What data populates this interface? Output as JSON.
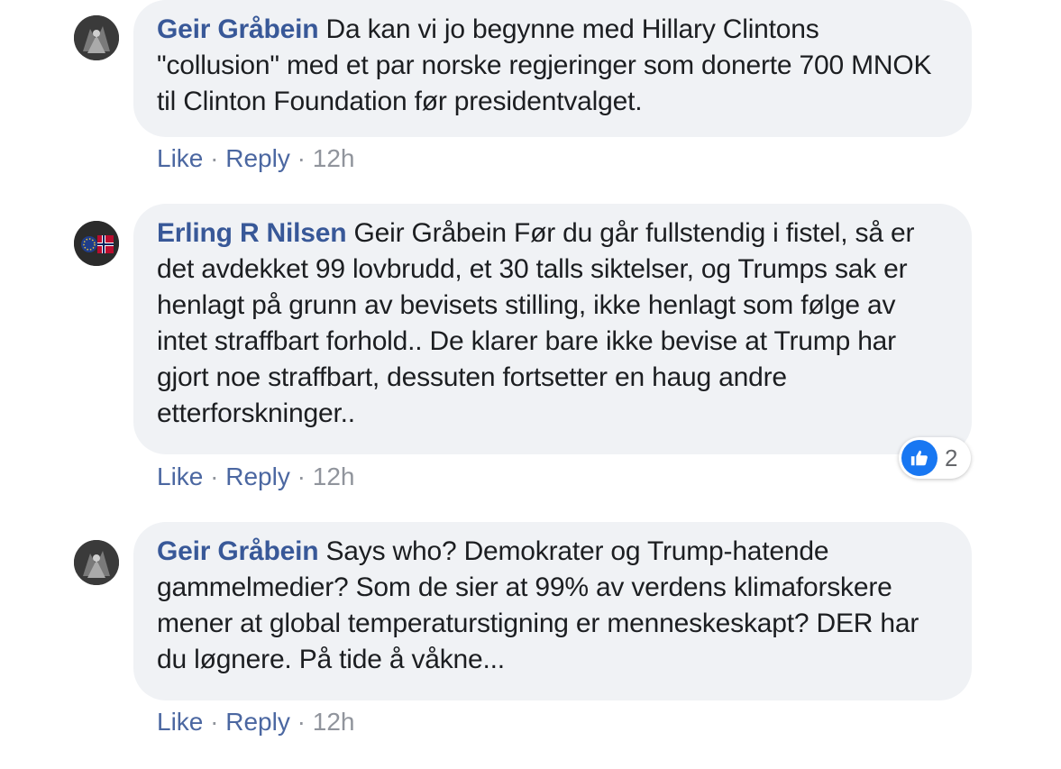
{
  "comments": [
    {
      "author": "Geir Gråbein",
      "text": "Da kan vi jo begynne med Hillary Clintons \"collusion\" med et par norske regjeringer som donerte 700 MNOK til Clinton Foundation før presidentvalget.",
      "like_label": "Like",
      "reply_label": "Reply",
      "time": "12h"
    },
    {
      "author": "Erling R Nilsen",
      "text": "Geir Gråbein Før du går fullstendig i fistel, så er det avdekket 99 lovbrudd, et 30 talls siktelser, og Trumps sak er henlagt på grunn av bevisets stilling, ikke henlagt som følge av intet straffbart forhold.. De klarer bare ikke bevise at Trump har gjort noe straffbart, dessuten fortsetter en haug andre etterforskninger..",
      "like_label": "Like",
      "reply_label": "Reply",
      "time": "12h",
      "reaction_icon": "thumbs-up-icon",
      "reaction_count": "2",
      "reaction_color": "#1877f2"
    },
    {
      "author": "Geir Gråbein",
      "text": "Says who? Demokrater og Trump-hatende gammelmedier? Som de sier at 99% av verdens klimaforskere mener at global temperaturstigning er menneskeskapt? DER har du løgnere. På tide å våkne...",
      "like_label": "Like",
      "reply_label": "Reply",
      "time": "12h"
    }
  ],
  "separator": "·",
  "link_color": "#385898",
  "bubble_color": "#f0f2f5"
}
